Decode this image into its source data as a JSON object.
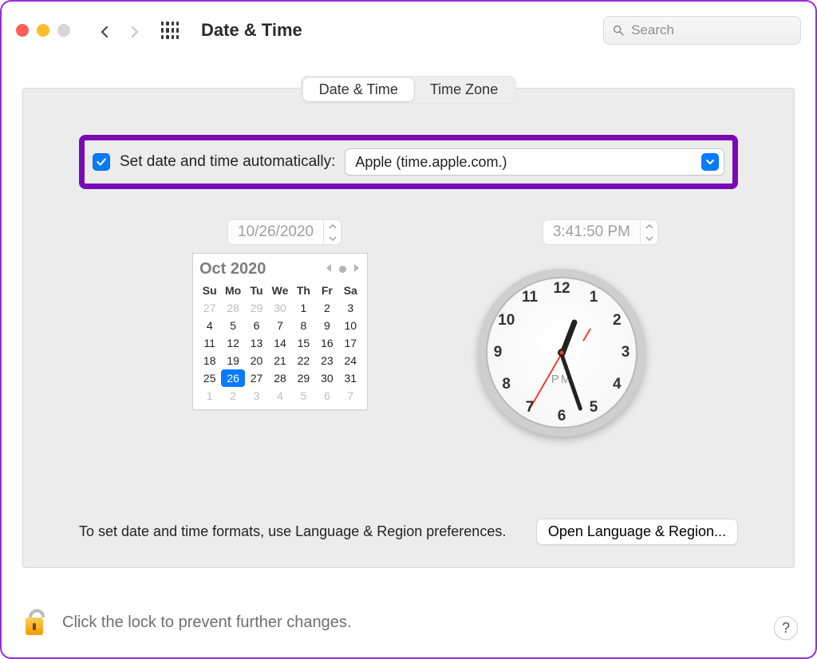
{
  "window": {
    "title": "Date & Time"
  },
  "search": {
    "placeholder": "Search"
  },
  "tabs": {
    "dateTime": "Date & Time",
    "timeZone": "Time Zone",
    "active": "dateTime"
  },
  "auto": {
    "label": "Set date and time automatically:",
    "server": "Apple (time.apple.com.)",
    "checked": true
  },
  "date_field": "10/26/2020",
  "time_field": "3:41:50 PM",
  "calendar": {
    "title": "Oct 2020",
    "dow": [
      "Su",
      "Mo",
      "Tu",
      "We",
      "Th",
      "Fr",
      "Sa"
    ],
    "leading_dim": [
      27,
      28,
      29,
      30
    ],
    "days": [
      1,
      2,
      3,
      4,
      5,
      6,
      7,
      8,
      9,
      10,
      11,
      12,
      13,
      14,
      15,
      16,
      17,
      18,
      19,
      20,
      21,
      22,
      23,
      24,
      25,
      26,
      27,
      28,
      29,
      30,
      31
    ],
    "trailing_dim": [
      1,
      2,
      3,
      4,
      5,
      6,
      7
    ],
    "selected": 26
  },
  "clock": {
    "numbers": [
      "12",
      "1",
      "2",
      "3",
      "4",
      "5",
      "6",
      "7",
      "8",
      "9",
      "10",
      "11"
    ],
    "ampm": "PM",
    "hour_angle": 21,
    "minute_angle": 161,
    "second_angle": 210
  },
  "hint": "To set date and time formats, use Language & Region preferences.",
  "open_btn": "Open Language & Region...",
  "lock_hint": "Click the lock to prevent further changes.",
  "help": "?"
}
